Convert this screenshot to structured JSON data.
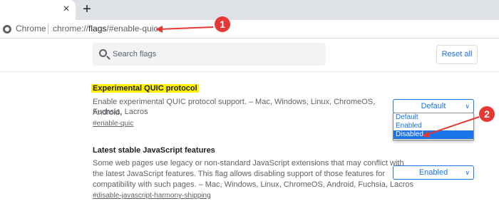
{
  "browser": {
    "chip_label": "Chrome",
    "url_prefix": "chrome://",
    "url_path": "flags",
    "url_suffix": "/#enable-quic",
    "tab_close": "×",
    "new_tab": "+"
  },
  "header": {
    "search_placeholder": "Search flags",
    "reset_label": "Reset all"
  },
  "flags": [
    {
      "title": "Experimental QUIC protocol",
      "description_line1": "Enable experimental QUIC protocol support. – Mac, Windows, Linux, ChromeOS, Android,",
      "description_line2": "Fuchsia, Lacros",
      "link": "#enable-quic",
      "selected": "Default",
      "options": [
        "Default",
        "Enabled",
        "Disabled"
      ],
      "highlighted_option": "Disabled"
    },
    {
      "title": "Latest stable JavaScript features",
      "description_line1": "Some web pages use legacy or non-standard JavaScript extensions that may conflict with",
      "description_line2": "the latest JavaScript features. This flag allows disabling support of those features for",
      "description_line3": "compatibility with such pages. – Mac, Windows, Linux, ChromeOS, Android, Fuchsia, Lacros",
      "link": "#disable-javascript-harmony-shipping",
      "selected": "Enabled"
    }
  ],
  "annotations": [
    {
      "number": "1",
      "color": "#e53935"
    },
    {
      "number": "2",
      "color": "#e53935"
    }
  ],
  "colors": {
    "accent": "#1a73e8",
    "highlight": "#fff200",
    "annotation": "#e53935"
  }
}
